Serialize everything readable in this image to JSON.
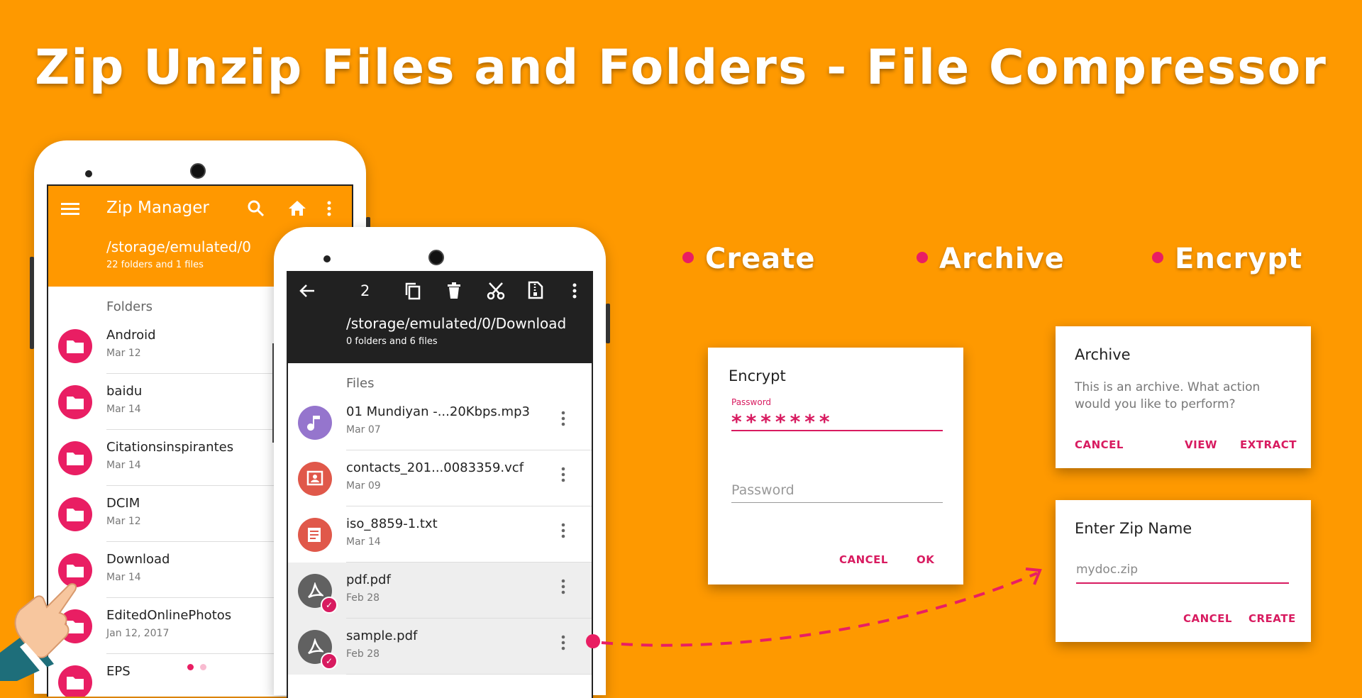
{
  "headline": "Zip Unzip Files and Folders - File Compressor",
  "colors": {
    "background": "#FE9900",
    "accent": "#D81B60",
    "primary": "#FF9800",
    "dark_toolbar": "#212121"
  },
  "phone1": {
    "app_title": "Zip Manager",
    "path": "/storage/emulated/0",
    "count": "22 folders and 1 files",
    "section": "Folders",
    "items": [
      {
        "name": "Android",
        "date": "Mar 12"
      },
      {
        "name": "baidu",
        "date": "Mar 14"
      },
      {
        "name": "Citationsinspirantes",
        "date": "Mar 14"
      },
      {
        "name": "DCIM",
        "date": "Mar 12"
      },
      {
        "name": "Download",
        "date": "Mar 14"
      },
      {
        "name": "EditedOnlinePhotos",
        "date": "Jan 12, 2017"
      },
      {
        "name": "EPS",
        "date": ""
      }
    ]
  },
  "phone2": {
    "selected_count": "2",
    "path": "/storage/emulated/0/Download",
    "count": "0 folders and 6 files",
    "section": "Files",
    "items": [
      {
        "name": "01 Mundiyan -...20Kbps.mp3",
        "date": "Mar 07",
        "icon": "music-icon"
      },
      {
        "name": "contacts_201...0083359.vcf",
        "date": "Mar 09",
        "icon": "contact-card-icon"
      },
      {
        "name": "iso_8859-1.txt",
        "date": "Mar 14",
        "icon": "text-file-icon"
      },
      {
        "name": "pdf.pdf",
        "date": "Feb 28",
        "icon": "pdf-icon"
      },
      {
        "name": "sample.pdf",
        "date": "Feb 28",
        "icon": "pdf-icon"
      }
    ]
  },
  "features": [
    "Create",
    "Archive",
    "Encrypt"
  ],
  "encrypt_dialog": {
    "title": "Encrypt",
    "password_label": "Password",
    "password_value": "*******",
    "confirm_placeholder": "Password",
    "cancel": "CANCEL",
    "ok": "OK"
  },
  "archive_dialog": {
    "title": "Archive",
    "message_line1": "This is an archive. What action",
    "message_line2": "would you like to perform?",
    "cancel": "CANCEL",
    "view": "VIEW",
    "extract": "EXTRACT"
  },
  "zipname_dialog": {
    "title": "Enter Zip Name",
    "value": "mydoc.zip",
    "cancel": "CANCEL",
    "create": "CREATE"
  }
}
